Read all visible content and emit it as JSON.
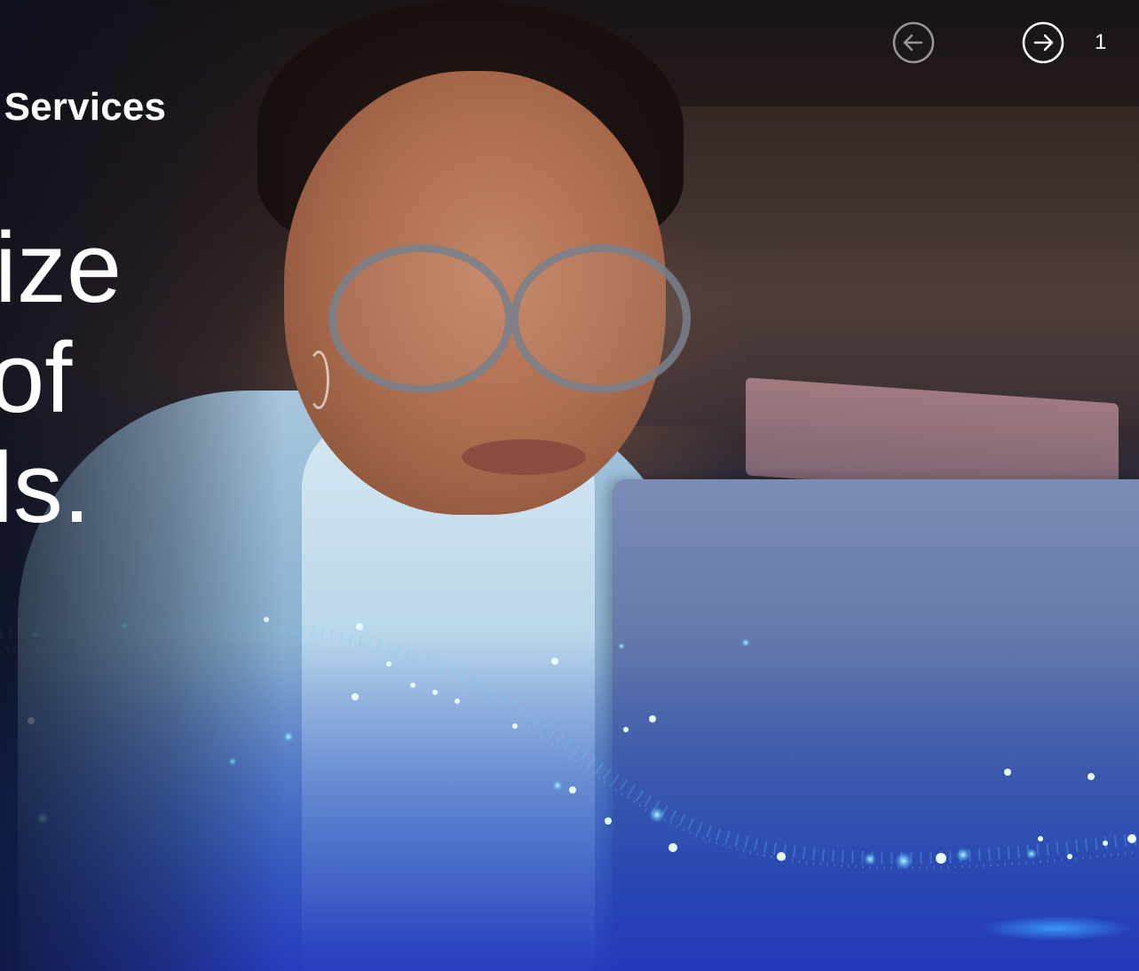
{
  "brand": {
    "name": "up Services"
  },
  "hero": {
    "headline_lines": [
      "ize",
      "of",
      "ls."
    ]
  },
  "carousel": {
    "prev_icon": "arrow-left-circle-icon",
    "next_icon": "arrow-right-circle-icon",
    "slide_number": "1"
  },
  "colors": {
    "text": "#ffffff",
    "accent_glow": "#5ad7ff",
    "bottom_blue": "#2438a8"
  }
}
